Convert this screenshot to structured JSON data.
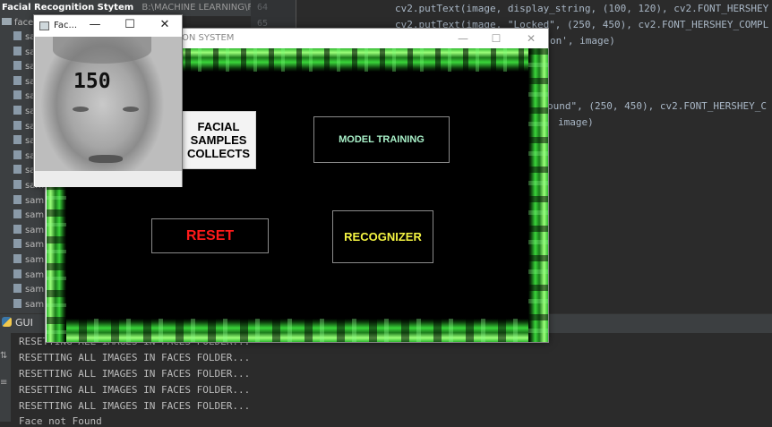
{
  "ide": {
    "project_name": "Facial Recognition Stytem",
    "project_path": "B:\\MACHINE LEARNING\\Facial Reco",
    "tree_folder": "faces",
    "tree_files": [
      "samp",
      "samp",
      "samp",
      "samp",
      "samp",
      "samp",
      "samp",
      "samp",
      "samp",
      "samp",
      "samp",
      "samp",
      "samp",
      "samp",
      "samp",
      "samp",
      "samp",
      "samp",
      "samp",
      "samp"
    ],
    "line_numbers": [
      "64",
      "65"
    ],
    "code_lines": [
      "cv2.putText(image, display_string, (100, 120), cv2.FONT_HERSHEY",
      "cv2.putText(image, \"Locked\", (250, 450), cv2.FONT_HERSHEY_COMPL"
    ],
    "code_tail_1": "on', image)",
    "code_tail_2": "ound\", (250, 450), cv2.FONT_HERSHEY_C",
    "code_tail_3": "image)",
    "run_tab_label": "GUI",
    "console_lines": [
      "RESETTING ALL IMAGES IN FACES FOLDER...",
      "RESETTING ALL IMAGES IN FACES FOLDER...",
      "RESETTING ALL IMAGES IN FACES FOLDER...",
      "RESETTING ALL IMAGES IN FACES FOLDER...",
      "RESETTING ALL IMAGES IN FACES FOLDER...",
      "Face not Found"
    ]
  },
  "main_window": {
    "title": "ON SYSTEM",
    "minimize_glyph": "—",
    "maximize_glyph": "☐",
    "close_glyph": "✕",
    "buttons": {
      "facial_samples": "FACIAL SAMPLES COLLECTS",
      "model_training": "MODEL TRAINING",
      "reset": "RESET",
      "recognizer": "RECOGNIZER"
    },
    "colors": {
      "facial_samples_text": "#000000",
      "model_training_text": "#a8f0c8",
      "reset_text": "#ff1a1a",
      "recognizer_text": "#f5f542",
      "frame_green": "#2fb82f"
    }
  },
  "camera_window": {
    "title": "Fac...",
    "minimize_glyph": "—",
    "maximize_glyph": "☐",
    "close_glyph": "✕",
    "sample_count": "150"
  }
}
